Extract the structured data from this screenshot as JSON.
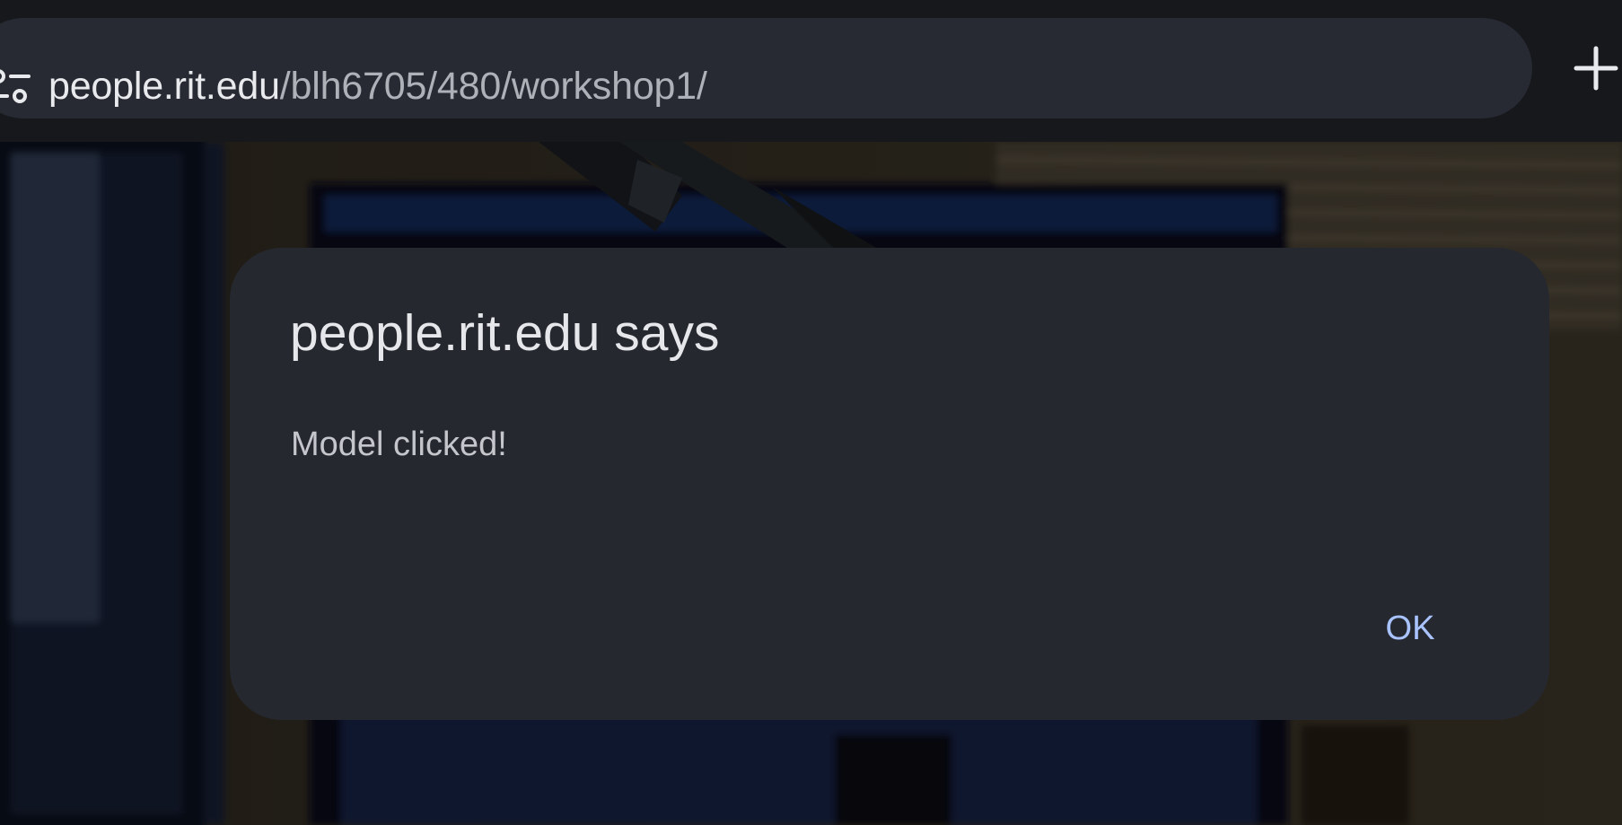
{
  "browser": {
    "url_host": "people.rit.edu",
    "url_path": "/blh6705/480/workshop1/",
    "site_info_icon": "tune-icon",
    "new_tab_icon": "plus-icon"
  },
  "dialog": {
    "title": "people.rit.edu says",
    "message": "Model clicked!",
    "ok_label": "OK"
  },
  "colors": {
    "toolbar_bg": "#17181c",
    "omnibox_bg": "#272a33",
    "dialog_bg": "#262830",
    "ok_accent": "#a9c3ff"
  }
}
